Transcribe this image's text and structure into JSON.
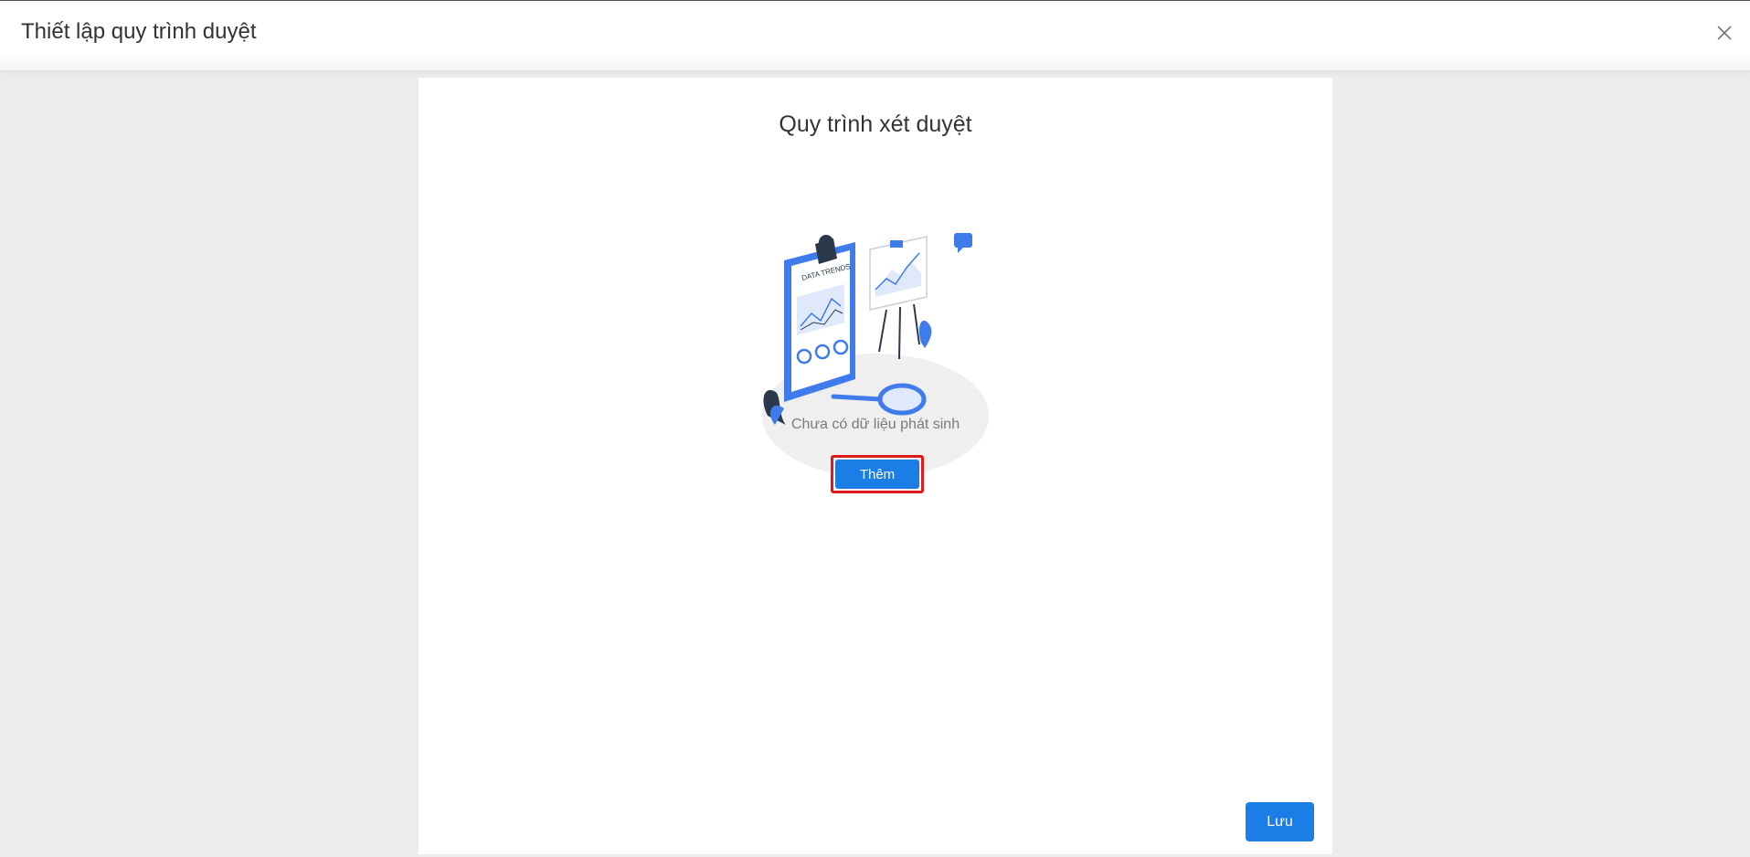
{
  "header": {
    "title": "Thiết lập quy trình duyệt",
    "close_icon": "close-icon"
  },
  "panel": {
    "title": "Quy trình xét duyệt",
    "illustration": {
      "clipboard_label": "DATA TRENDS"
    },
    "empty_text": "Chưa có dữ liệu phát sinh",
    "add_label": "Thêm",
    "save_label": "Lưu"
  },
  "colors": {
    "accent": "#1a7ee6",
    "highlight_border": "#e01a1a",
    "background": "#ececec"
  }
}
